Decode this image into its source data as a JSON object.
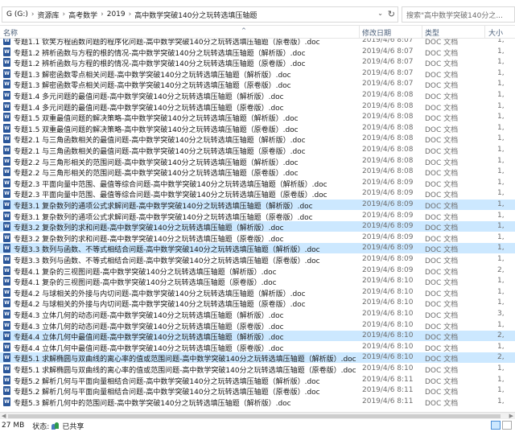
{
  "address": {
    "breadcrumbs": [
      "G (G:)",
      "资源库",
      "高考数学",
      "2019",
      "高中数学突破140分之玩转选填压轴题"
    ],
    "search_placeholder": "搜索\"高中数学突破140分之..."
  },
  "columns": {
    "name": "名称",
    "date": "修改日期",
    "type": "类型",
    "size": "大小"
  },
  "files": [
    {
      "name": "专题1.1 钦笑方程函数问题的程序化问题-高中数学突破140分之玩转选填压轴题（原卷版）.doc",
      "date": "2019/4/6 8:07",
      "type": "DOC 文档",
      "size": "1,",
      "selected": false
    },
    {
      "name": "专题1.2 辨析函数与方程的根的情况-高中数学突破140分之玩转选填压轴题（解析版）.doc",
      "date": "2019/4/6 8:07",
      "type": "DOC 文档",
      "size": "1,",
      "selected": false
    },
    {
      "name": "专题1.2 辨析函数与方程的根的情况-高中数学突破140分之玩转选填压轴题（原卷版）.doc",
      "date": "2019/4/6 8:07",
      "type": "DOC 文档",
      "size": "1,",
      "selected": false
    },
    {
      "name": "专题1.3 解密函数零点相关问题-高中数学突破140分之玩转选填压轴题（解析版）.doc",
      "date": "2019/4/6 8:07",
      "type": "DOC 文档",
      "size": "1,",
      "selected": false
    },
    {
      "name": "专题1.3 解密函数零点相关问题-高中数学突破140分之玩转选填压轴题（原卷版）.doc",
      "date": "2019/4/6 8:07",
      "type": "DOC 文档",
      "size": "1,",
      "selected": false
    },
    {
      "name": "专题1.4 多元问题的最值问题-高中数学突破140分之玩转选填压轴题（解析版）.doc",
      "date": "2019/4/6 8:08",
      "type": "DOC 文档",
      "size": "1,",
      "selected": false
    },
    {
      "name": "专题1.4 多元问题的最值问题-高中数学突破140分之玩转选填压轴题（原卷版）.doc",
      "date": "2019/4/6 8:08",
      "type": "DOC 文档",
      "size": "1,",
      "selected": false
    },
    {
      "name": "专题1.5 双重最值问题的解决策略-高中数学突破140分之玩转选填压轴题（解析版）.doc",
      "date": "2019/4/6 8:08",
      "type": "DOC 文档",
      "size": "1,",
      "selected": false
    },
    {
      "name": "专题1.5 双重最值问题的解决策略-高中数学突破140分之玩转选填压轴题（原卷版）.doc",
      "date": "2019/4/6 8:08",
      "type": "DOC 文档",
      "size": "1,",
      "selected": false
    },
    {
      "name": "专题2.1 与三角函数相关的最值问题-高中数学突破140分之玩转选填压轴题（解析版）.doc",
      "date": "2019/4/6 8:08",
      "type": "DOC 文档",
      "size": "1,",
      "selected": false
    },
    {
      "name": "专题2.1 与三角函数相关的最值问题-高中数学突破140分之玩转选填压轴题（原卷版）.doc",
      "date": "2019/4/6 8:08",
      "type": "DOC 文档",
      "size": "1,",
      "selected": false
    },
    {
      "name": "专题2.2 与三角形相关的范围问题-高中数学突破140分之玩转选填压轴题（解析版）.doc",
      "date": "2019/4/6 8:08",
      "type": "DOC 文档",
      "size": "1,",
      "selected": false
    },
    {
      "name": "专题2.2 与三角形相关的范围问题-高中数学突破140分之玩转选填压轴题（原卷版）.doc",
      "date": "2019/4/6 8:08",
      "type": "DOC 文档",
      "size": "1,",
      "selected": false
    },
    {
      "name": "专题2.3 平面向量中范围、最值等综合问题-高中数学突破140分之玩转选填压轴题（解析版）.doc",
      "date": "2019/4/6 8:09",
      "type": "DOC 文档",
      "size": "1,",
      "selected": false
    },
    {
      "name": "专题2.3 平面向量中范围、最值等综合问题-高中数学突破140分之玩转选填压轴题（原卷版）.doc",
      "date": "2019/4/6 8:09",
      "type": "DOC 文档",
      "size": "1,",
      "selected": false
    },
    {
      "name": "专题3.1 复杂数列的通项公式求解问题-高中数学突破140分之玩转选填压轴题（解析版）.doc",
      "date": "2019/4/6 8:09",
      "type": "DOC 文档",
      "size": "1,",
      "selected": true
    },
    {
      "name": "专题3.1 复杂数列的通项公式求解问题-高中数学突破140分之玩转选填压轴题（原卷版）.doc",
      "date": "2019/4/6 8:09",
      "type": "DOC 文档",
      "size": "1,",
      "selected": false
    },
    {
      "name": "专题3.2 复杂数列的求和问题-高中数学突破140分之玩转选填压轴题（解析版）.doc",
      "date": "2019/4/6 8:09",
      "type": "DOC 文档",
      "size": "1,",
      "selected": true
    },
    {
      "name": "专题3.2 复杂数列的求和问题-高中数学突破140分之玩转选填压轴题（原卷版）.doc",
      "date": "2019/4/6 8:09",
      "type": "DOC 文档",
      "size": "1,",
      "selected": false
    },
    {
      "name": "专题3.3 数列与函数、不等式相结合问题-高中数学突破140分之玩转选填压轴题（解析版）.doc",
      "date": "2019/4/6 8:09",
      "type": "DOC 文档",
      "size": "1,",
      "selected": true
    },
    {
      "name": "专题3.3 数列与函数、不等式相结合问题-高中数学突破140分之玩转选填压轴题（原卷版）.doc",
      "date": "2019/4/6 8:09",
      "type": "DOC 文档",
      "size": "1,",
      "selected": false
    },
    {
      "name": "专题4.1 复杂的三视图问题-高中数学突破140分之玩转选填压轴题（解析版）.doc",
      "date": "2019/4/6 8:09",
      "type": "DOC 文档",
      "size": "2,",
      "selected": false
    },
    {
      "name": "专题4.1 复杂的三视图问题-高中数学突破140分之玩转选填压轴题（原卷版）.doc",
      "date": "2019/4/6 8:10",
      "type": "DOC 文档",
      "size": "1,",
      "selected": false
    },
    {
      "name": "专题4.2 与球相关的外接与内切问题-高中数学突破140分之玩转选填压轴题（解析版）.doc",
      "date": "2019/4/6 8:10",
      "type": "DOC 文档",
      "size": "1,",
      "selected": false
    },
    {
      "name": "专题4.2 与球相关的外接与内切问题-高中数学突破140分之玩转选填压轴题（原卷版）.doc",
      "date": "2019/4/6 8:10",
      "type": "DOC 文档",
      "size": "1,",
      "selected": false
    },
    {
      "name": "专题4.3 立体几何的动态问题-高中数学突破140分之玩转选填压轴题（解析版）.doc",
      "date": "2019/4/6 8:10",
      "type": "DOC 文档",
      "size": "3,",
      "selected": false
    },
    {
      "name": "专题4.3 立体几何的动态问题-高中数学突破140分之玩转选填压轴题（原卷版）.doc",
      "date": "2019/4/6 8:10",
      "type": "DOC 文档",
      "size": "1,",
      "selected": false
    },
    {
      "name": "专题4.4 立体几何中最值问题-高中数学突破140分之玩转选填压轴题（解析版）.doc",
      "date": "2019/4/6 8:10",
      "type": "DOC 文档",
      "size": "2,",
      "selected": true
    },
    {
      "name": "专题4.4 立体几何中最值问题-高中数学突破140分之玩转选填压轴题（原卷版）.doc",
      "date": "2019/4/6 8:10",
      "type": "DOC 文档",
      "size": "1,",
      "selected": false
    },
    {
      "name": "专题5.1 求解椭圆与双曲线的离心率的值或范围问题-高中数学突破140分之玩转选填压轴题（解析版）.doc",
      "date": "2019/4/6 8:10",
      "type": "DOC 文档",
      "size": "2,",
      "selected": true
    },
    {
      "name": "专题5.1 求解椭圆与双曲线的离心率的值或范围问题-高中数学突破140分之玩转选填压轴题（原卷版）.doc",
      "date": "2019/4/6 8:10",
      "type": "DOC 文档",
      "size": "1,",
      "selected": false
    },
    {
      "name": "专题5.2 解析几何与平面向量相结合问题-高中数学突破140分之玩转选填压轴题（解析版）.doc",
      "date": "2019/4/6 8:11",
      "type": "DOC 文档",
      "size": "1,",
      "selected": false
    },
    {
      "name": "专题5.2 解析几何与平面向量相结合问题-高中数学突破140分之玩转选填压轴题（原卷版）.doc",
      "date": "2019/4/6 8:11",
      "type": "DOC 文档",
      "size": "1,",
      "selected": false
    },
    {
      "name": "专题5.3 解析几何中的范围问题-高中数学突破140分之玩转选填压轴题（解析版）.doc",
      "date": "2019/4/6 8:11",
      "type": "DOC 文档",
      "size": "1,",
      "selected": false
    }
  ],
  "status": {
    "size_text": "27 MB",
    "state_label": "状态:",
    "state_value": "已共享"
  }
}
